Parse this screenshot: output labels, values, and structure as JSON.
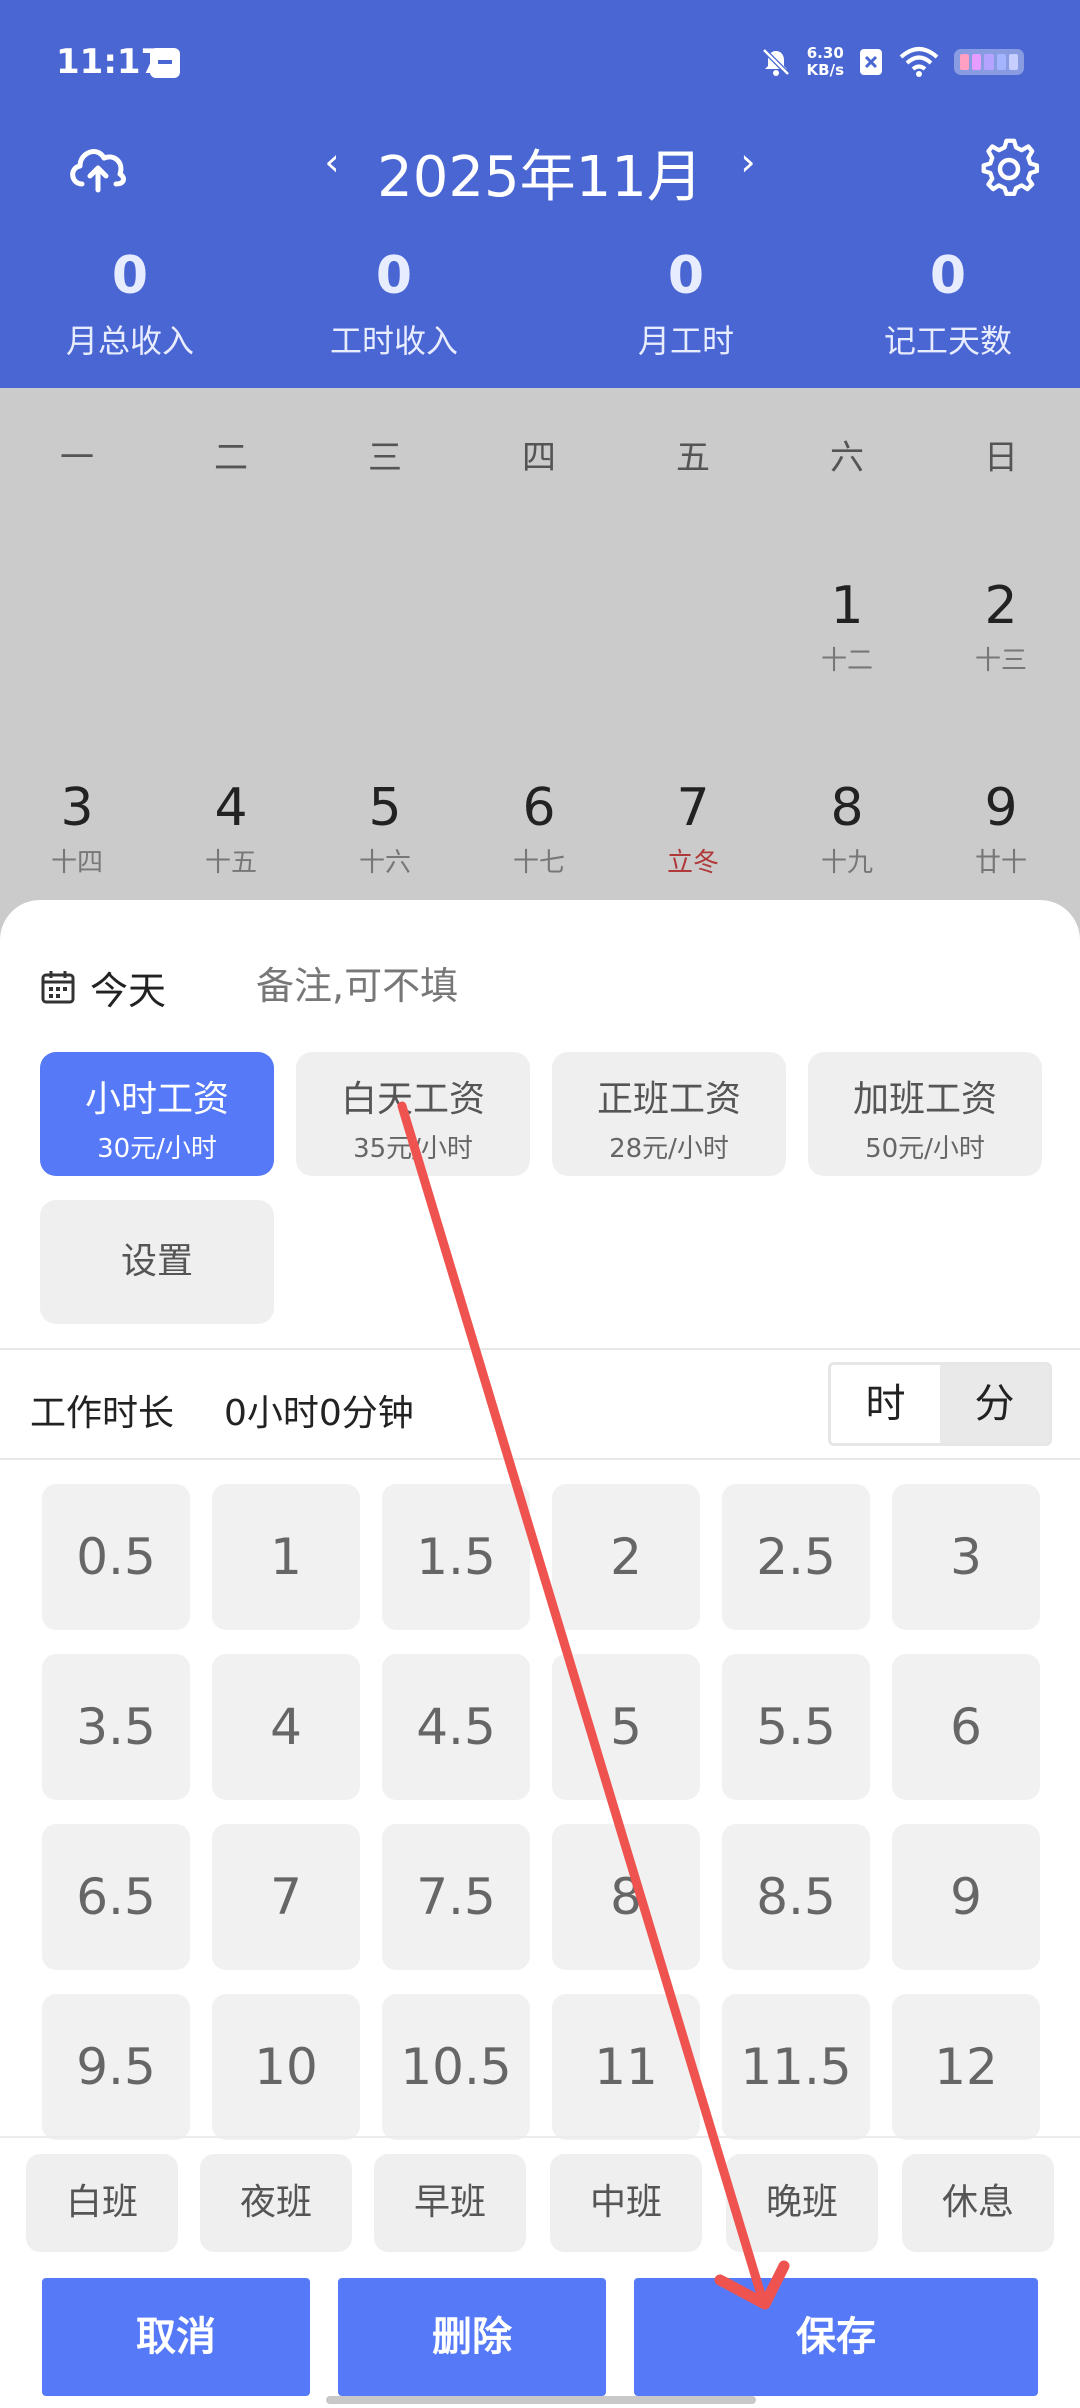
{
  "status_bar": {
    "time": "11:17",
    "net_speed_value": "6.30",
    "net_speed_unit": "KB/s"
  },
  "header": {
    "month_title": "2025年11月",
    "prev_glyph": "‹",
    "next_glyph": "›",
    "summary": [
      {
        "value": "0",
        "label": "月总收入"
      },
      {
        "value": "0",
        "label": "工时收入"
      },
      {
        "value": "0",
        "label": "月工时"
      },
      {
        "value": "0",
        "label": "记工天数"
      }
    ]
  },
  "calendar": {
    "weekdays": [
      "一",
      "二",
      "三",
      "四",
      "五",
      "六",
      "日"
    ],
    "days": [
      {
        "day": "1",
        "lunar": "十二"
      },
      {
        "day": "2",
        "lunar": "十三"
      },
      {
        "day": "3",
        "lunar": "十四"
      },
      {
        "day": "4",
        "lunar": "十五"
      },
      {
        "day": "5",
        "lunar": "十六"
      },
      {
        "day": "6",
        "lunar": "十七"
      },
      {
        "day": "7",
        "lunar": "立冬"
      },
      {
        "day": "8",
        "lunar": "十九"
      },
      {
        "day": "9",
        "lunar": "廿十"
      }
    ]
  },
  "sheet": {
    "date_label": "今天",
    "note_placeholder": "备注,可不填",
    "wage_options": [
      {
        "title": "小时工资",
        "price": "30元/小时",
        "selected": true
      },
      {
        "title": "白天工资",
        "price": "35元/小时",
        "selected": false
      },
      {
        "title": "正班工资",
        "price": "28元/小时",
        "selected": false
      },
      {
        "title": "加班工资",
        "price": "50元/小时",
        "selected": false
      }
    ],
    "settings_label": "设置",
    "duration_label": "工作时长",
    "duration_value": "0小时0分钟",
    "unit_hour": "时",
    "unit_minute": "分",
    "hour_options": [
      "0.5",
      "1",
      "1.5",
      "2",
      "2.5",
      "3",
      "3.5",
      "4",
      "4.5",
      "5",
      "5.5",
      "6",
      "6.5",
      "7",
      "7.5",
      "8",
      "8.5",
      "9",
      "9.5",
      "10",
      "10.5",
      "11",
      "11.5",
      "12"
    ],
    "shifts": [
      "白班",
      "夜班",
      "早班",
      "中班",
      "晚班",
      "休息"
    ],
    "actions": {
      "cancel": "取消",
      "delete": "删除",
      "save": "保存"
    }
  },
  "colors": {
    "header_bg": "#4a66d2",
    "accent": "#5579f7",
    "annotation_arrow": "#ef5350",
    "solar_term": "#b03a3a"
  }
}
